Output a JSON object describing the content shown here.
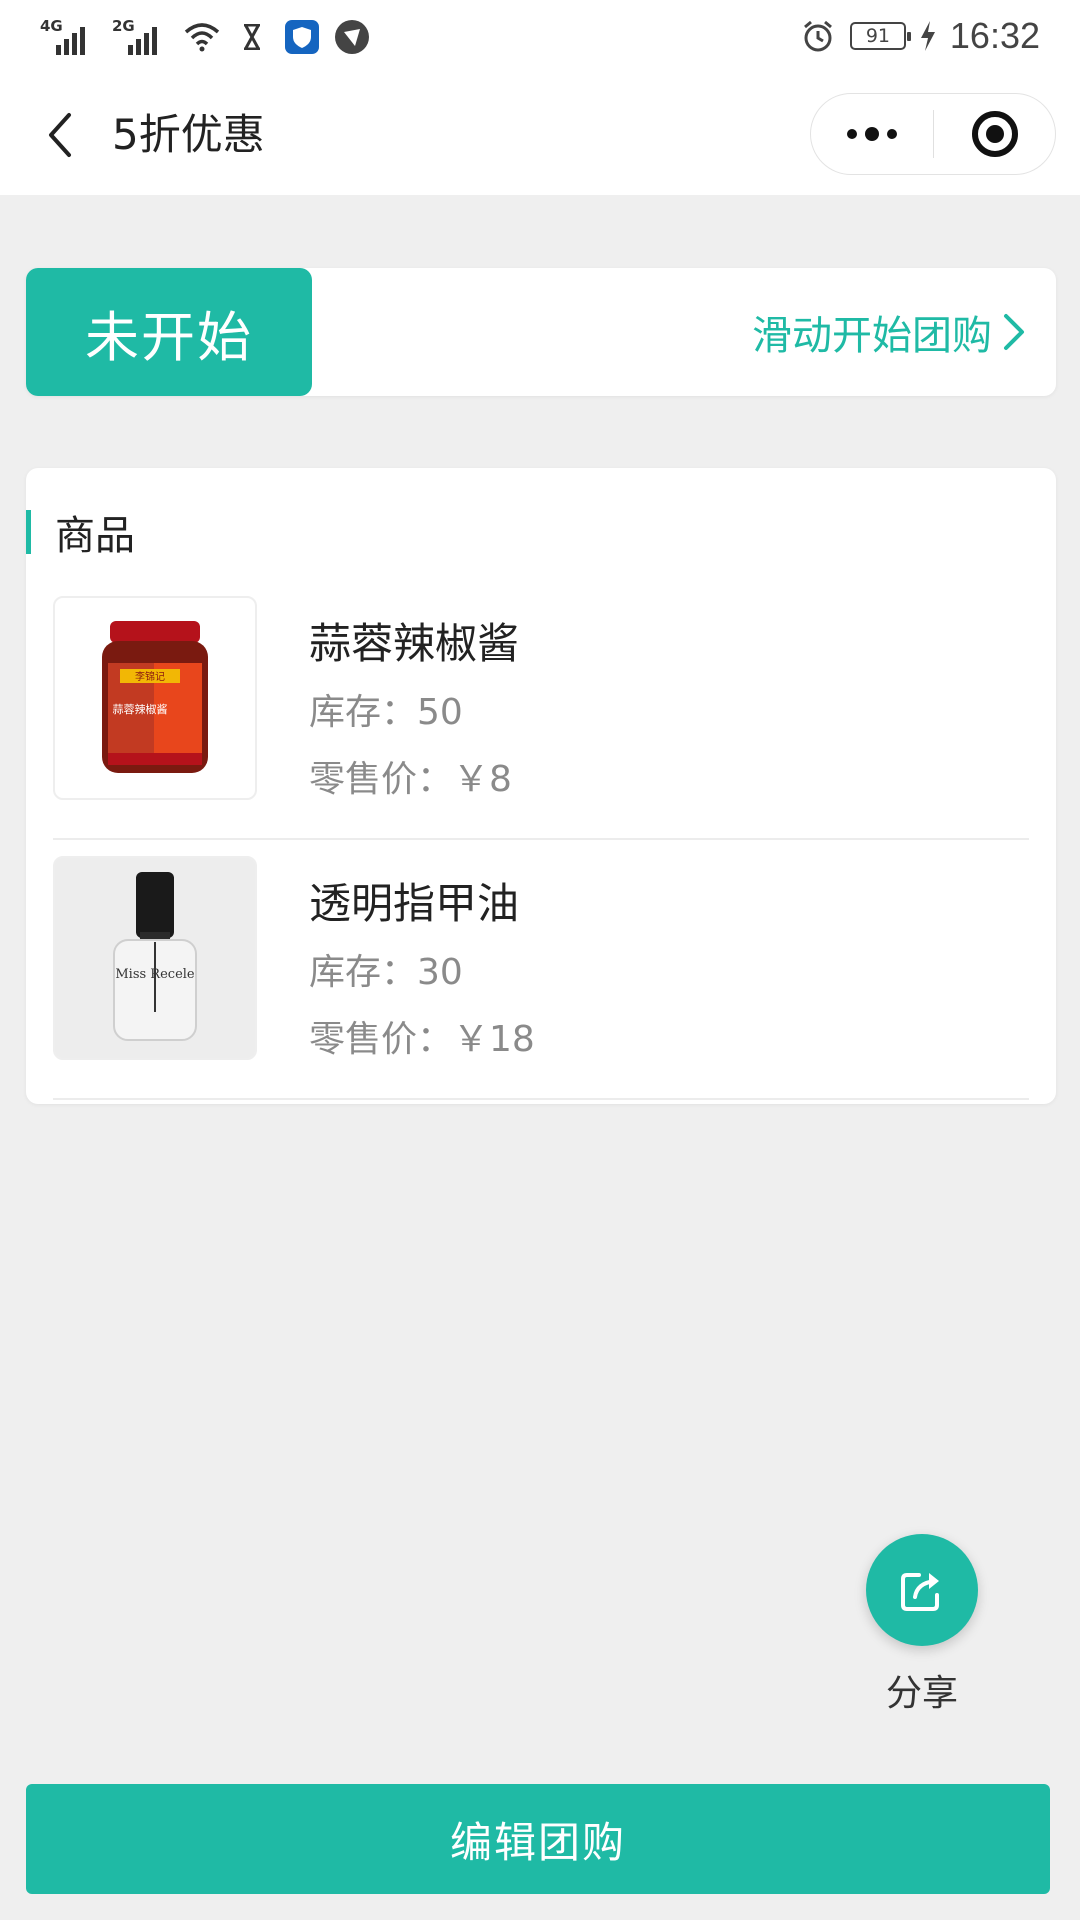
{
  "status_bar": {
    "network_1": "4G",
    "network_2": "2G",
    "battery": "91",
    "time": "16:32",
    "icons": [
      "signal-icon",
      "wifi-icon",
      "hourglass-icon",
      "shield-app-icon",
      "app-icon",
      "alarm-icon",
      "battery-icon",
      "charging-icon"
    ]
  },
  "navbar": {
    "title": "5折优惠",
    "back_icon": "chevron-left-icon",
    "more_icon": "more-dots-icon",
    "close_icon": "target-circle-icon"
  },
  "slide": {
    "status_label": "未开始",
    "hint": "滑动开始团购",
    "hint_icon": "chevron-right-icon"
  },
  "products": {
    "section_title": "商品",
    "items": [
      {
        "name": "蒜蓉辣椒酱",
        "stock": "库存：50",
        "price": "零售价：￥8",
        "image_label": "李锦记",
        "image_sub": "蒜蓉辣椒酱"
      },
      {
        "name": "透明指甲油",
        "stock": "库存：30",
        "price": "零售价：￥18",
        "image_label": "Miss Recele"
      }
    ]
  },
  "share": {
    "label": "分享",
    "icon": "share-icon"
  },
  "bottom_button": {
    "label": "编辑团购"
  },
  "colors": {
    "accent": "#1fbaa5",
    "background": "#efefef",
    "card": "#ffffff",
    "muted_text": "#8a8a8a"
  }
}
